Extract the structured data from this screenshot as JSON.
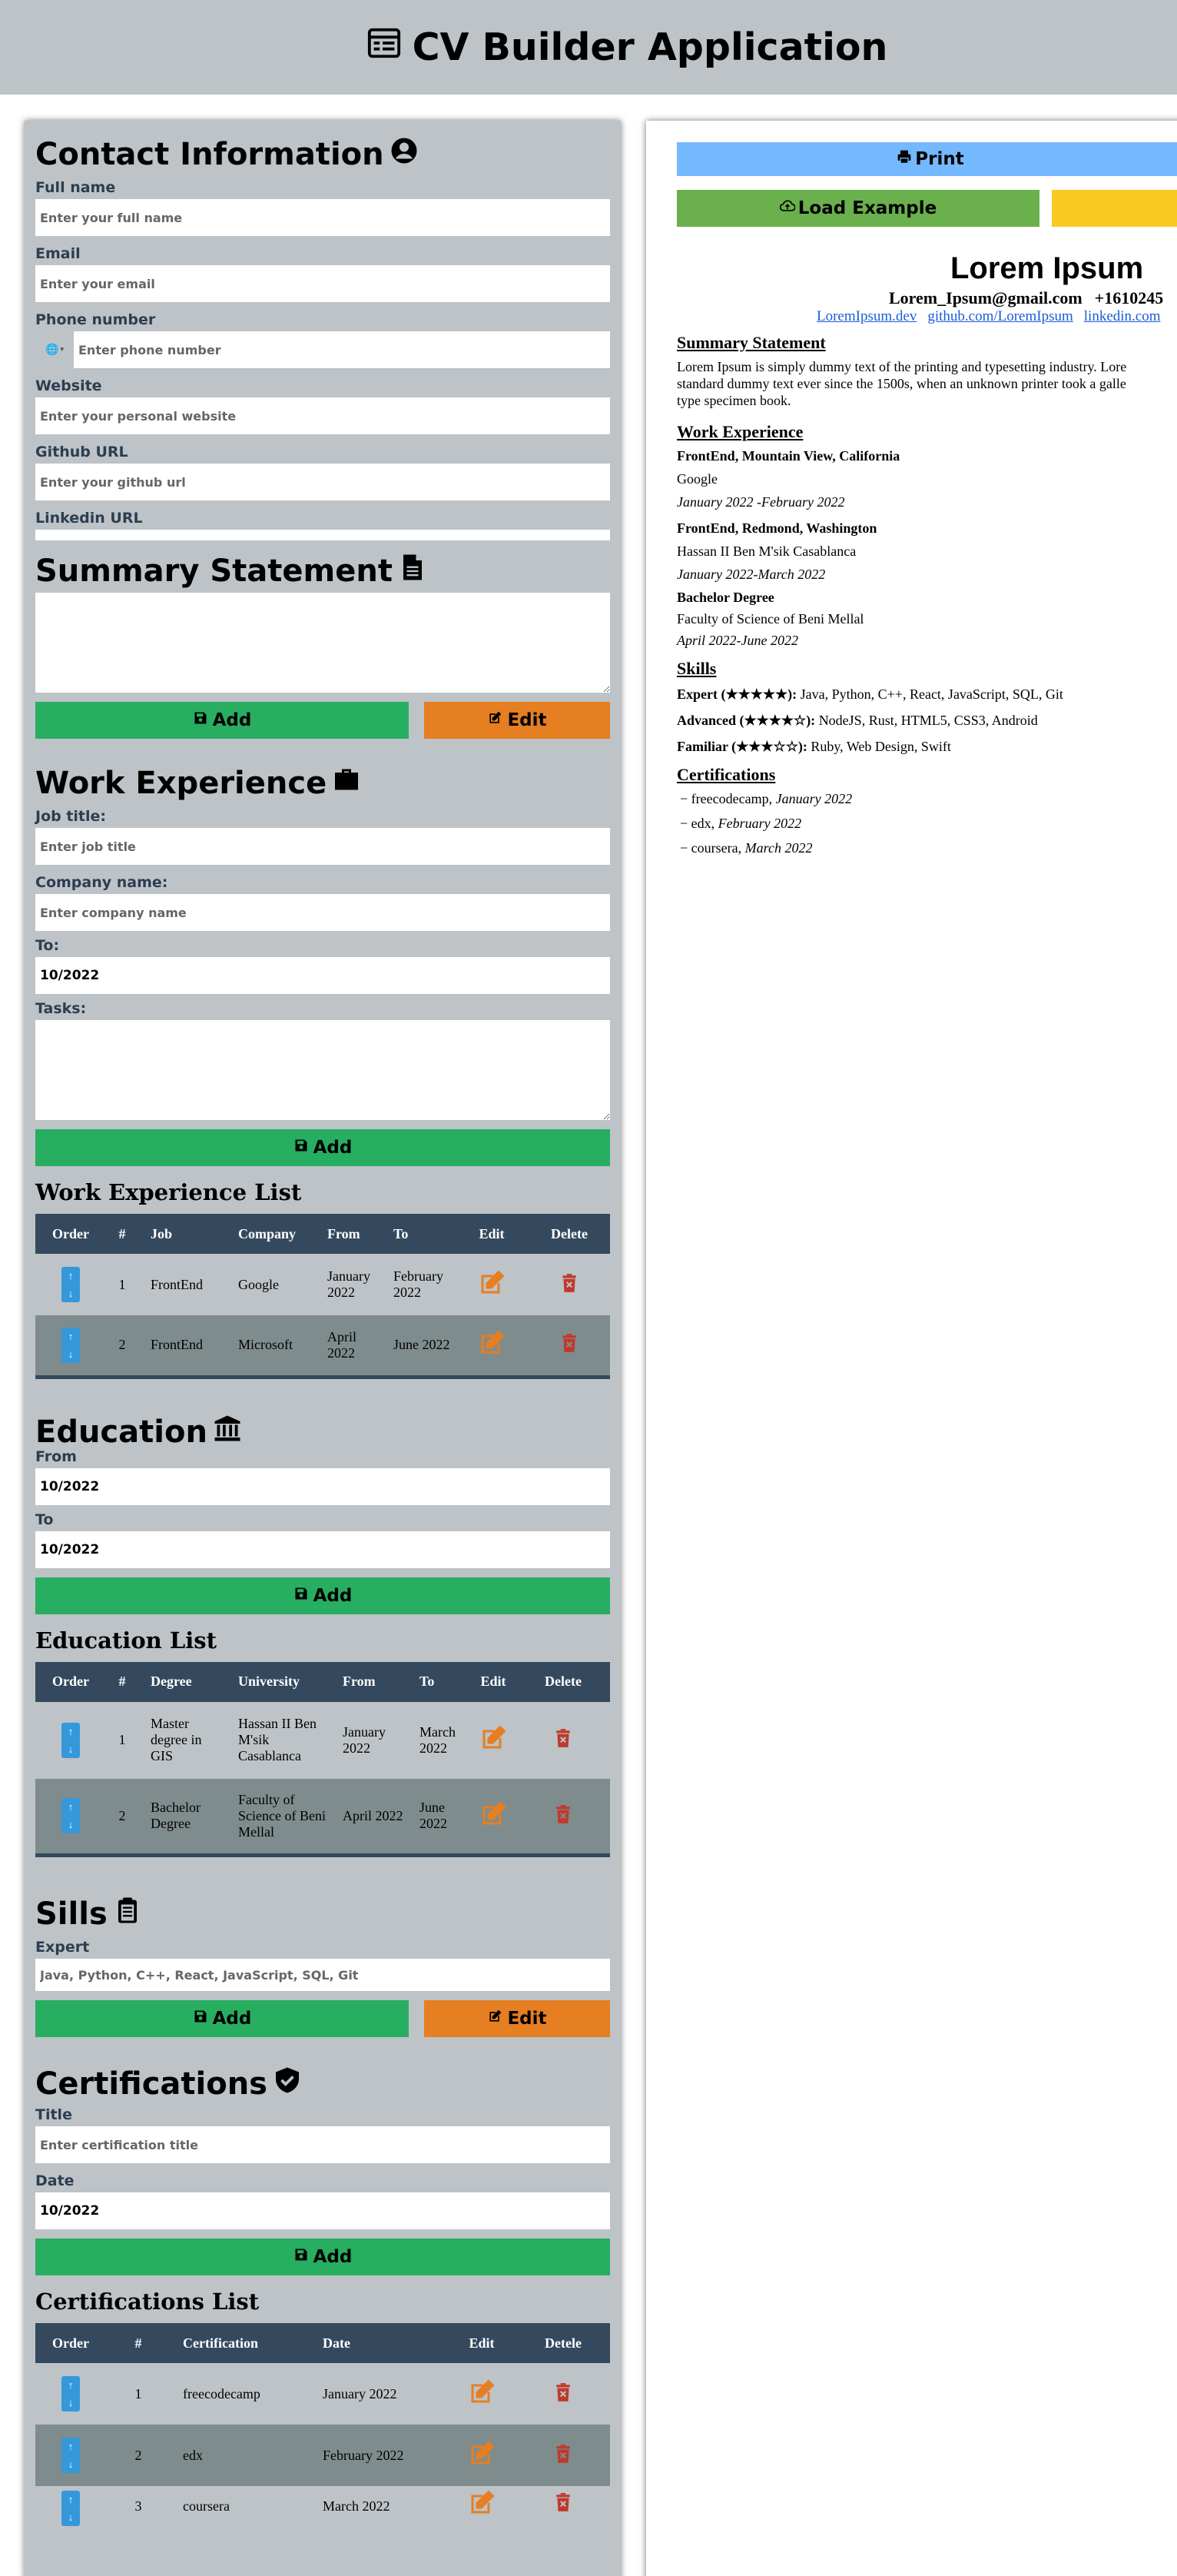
{
  "header": {
    "title": "CV Builder Application",
    "icon": "form-icon"
  },
  "contact": {
    "title": "Contact Information",
    "full_name_label": "Full name",
    "full_name_placeholder": "Enter your full name",
    "email_label": "Email",
    "email_placeholder": "Enter your email",
    "phone_label": "Phone number",
    "phone_placeholder": "Enter phone number",
    "website_label": "Website",
    "website_placeholder": "Enter your personal website",
    "github_label": "Github URL",
    "github_placeholder": "Enter your github url",
    "linkedin_label": "Linkedin URL"
  },
  "summary": {
    "title": "Summary Statement",
    "add_label": "Add",
    "edit_label": "Edit"
  },
  "work": {
    "title": "Work Experience",
    "job_label": "Job title:",
    "job_placeholder": "Enter job title",
    "company_label": "Company name:",
    "company_placeholder": "Enter company name",
    "to_label": "To:",
    "to_value": "10/2022",
    "tasks_label": "Tasks:",
    "add_label": "Add",
    "list_title": "Work Experience List",
    "columns": [
      "Order",
      "#",
      "Job",
      "Company",
      "From",
      "To",
      "Edit",
      "Delete"
    ],
    "rows": [
      {
        "num": "1",
        "job": "FrontEnd",
        "company": "Google",
        "from": "January 2022",
        "to": "February 2022"
      },
      {
        "num": "2",
        "job": "FrontEnd",
        "company": "Microsoft",
        "from": "April 2022",
        "to": "June 2022"
      }
    ]
  },
  "education": {
    "title": "Education",
    "from_label": "From",
    "from_value": "10/2022",
    "to_label": "To",
    "to_value": "10/2022",
    "add_label": "Add",
    "list_title": "Education List",
    "columns": [
      "Order",
      "#",
      "Degree",
      "University",
      "From",
      "To",
      "Edit",
      "Delete"
    ],
    "rows": [
      {
        "num": "1",
        "degree": "Master degree in GIS",
        "university": "Hassan II Ben M'sik Casablanca",
        "from": "January 2022",
        "to": "March 2022"
      },
      {
        "num": "2",
        "degree": "Bachelor Degree",
        "university": "Faculty of Science of Beni Mellal",
        "from": "April 2022",
        "to": "June 2022"
      }
    ]
  },
  "skills": {
    "title": "Sills",
    "expert_label": "Expert",
    "expert_placeholder": "Java, Python, C++, React, JavaScript, SQL, Git",
    "add_label": "Add",
    "edit_label": "Edit"
  },
  "certifications": {
    "title": "Certifications",
    "title_label": "Title",
    "title_placeholder": "Enter certification title",
    "date_label": "Date",
    "date_value": "10/2022",
    "add_label": "Add",
    "list_title": "Certifications List",
    "columns": [
      "Order",
      "#",
      "Certification",
      "Date",
      "Edit",
      "Detele"
    ],
    "rows": [
      {
        "num": "1",
        "name": "freecodecamp",
        "date": "January 2022"
      },
      {
        "num": "2",
        "name": "edx",
        "date": "February 2022"
      },
      {
        "num": "3",
        "name": "coursera",
        "date": "March 2022"
      }
    ]
  },
  "preview": {
    "print_label": "Print",
    "load_label": "Load Example",
    "name": "Lorem Ipsum",
    "email": "Lorem_Ipsum@gmail.com",
    "phone": "+1610245",
    "links": [
      "LoremIpsum.dev",
      "github.com/LoremIpsum",
      "linkedin.com"
    ],
    "summary_heading": "Summary Statement",
    "summary_lines": [
      "Lorem Ipsum is simply dummy text of the printing and typesetting industry. Lore",
      "standard dummy text ever since the 1500s, when an unknown printer took a galle",
      "type specimen book."
    ],
    "work_heading": "Work Experience",
    "work_items": [
      {
        "title": "FrontEnd, Mountain View, California",
        "company": "Google",
        "dates": "January 2022 -February 2022"
      },
      {
        "title": "FrontEnd, Redmond, Washington",
        "company": "Hassan II Ben M'sik Casablanca",
        "dates": "January 2022-March 2022"
      },
      {
        "title": "Bachelor Degree",
        "company": "Faculty of Science of Beni Mellal",
        "dates": "April 2022-June 2022"
      }
    ],
    "skills_heading": "Skills",
    "skills": [
      {
        "level": "Expert (★★★★★):",
        "list": " Java, Python, C++, React, JavaScript, SQL, Git"
      },
      {
        "level": "Advanced (★★★★☆):",
        "list": " NodeJS, Rust, HTML5, CSS3, Android"
      },
      {
        "level": "Familiar (★★★☆☆):",
        "list": " Ruby, Web Design, Swift"
      }
    ],
    "cert_heading": "Certifications",
    "certs": [
      {
        "name": "freecodecamp, ",
        "date": "January 2022"
      },
      {
        "name": "edx, ",
        "date": "February 2022"
      },
      {
        "name": "coursera, ",
        "date": "March 2022"
      }
    ]
  }
}
